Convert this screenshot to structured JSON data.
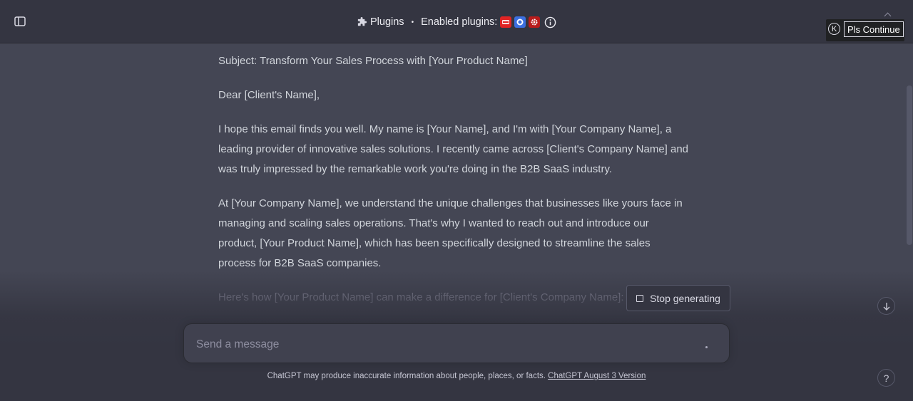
{
  "header": {
    "model_label": "Plugins",
    "separator": "•",
    "enabled_plugins_label": "Enabled plugins:",
    "plugin_icons": [
      "plugin-red-icon",
      "plugin-blue-icon",
      "plugin-gear-icon"
    ],
    "icons": {
      "sidebar": "sidebar-toggle-icon",
      "model": "puzzle-icon",
      "info": "info-icon"
    }
  },
  "extension": {
    "k_label": "K",
    "continue_label": "Pls Continue"
  },
  "message": {
    "paragraphs": [
      "Subject: Transform Your Sales Process with [Your Product Name]",
      "Dear [Client's Name],",
      "I hope this email finds you well. My name is [Your Name], and I'm with [Your Company Name], a leading provider of innovative sales solutions. I recently came across [Client's Company Name] and was truly impressed by the remarkable work you're doing in the B2B SaaS industry.",
      "At [Your Company Name], we understand the unique challenges that businesses like yours face in managing and scaling sales operations. That's why I wanted to reach out and introduce our product, [Your Product Name], which has been specifically designed to streamline the sales process for B2B SaaS companies.",
      "Here's how [Your Product Name] can make a difference for [Client's Company Name]:"
    ]
  },
  "controls": {
    "stop_label": "Stop generating",
    "input_placeholder": "Send a message",
    "help_label": "?"
  },
  "footer": {
    "text": "ChatGPT may produce inaccurate information about people, places, or facts. ",
    "link": "ChatGPT August 3 Version"
  },
  "colors": {
    "page_bg": "#444654",
    "topbar_bg": "#343541",
    "text": "#d1d5db",
    "muted": "#8e8ea0"
  }
}
